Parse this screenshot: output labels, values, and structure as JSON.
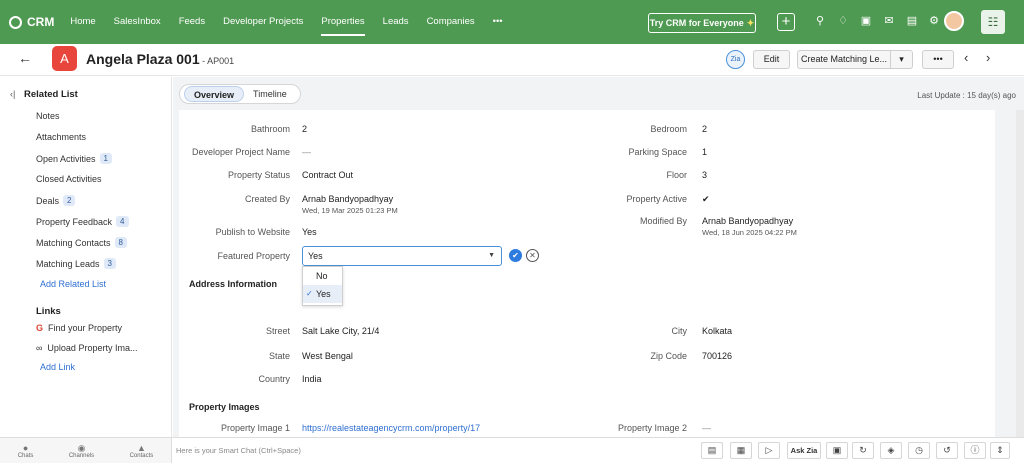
{
  "topbar": {
    "app_name": "CRM",
    "nav": [
      "Home",
      "SalesInbox",
      "Feeds",
      "Developer Projects",
      "Properties",
      "Leads",
      "Companies",
      "•••"
    ],
    "active_nav": "Properties",
    "try_button": "Try CRM for Everyone",
    "plus_label": "+",
    "icons": [
      "search-icon",
      "bell-icon",
      "calendar-icon",
      "mail-icon",
      "store-icon",
      "gear-icon"
    ],
    "apps_label": "☷",
    "accent": "#4f9a52"
  },
  "record": {
    "back": "←",
    "avatar_letter": "A",
    "title": "Angela Plaza 001",
    "code": " - AP001",
    "zia_label": "Zia",
    "edit_label": "Edit",
    "create_matching_label": "Create Matching Le...",
    "dropdown_caret": "▾",
    "more_label": "•••",
    "prev": "‹",
    "next": "›"
  },
  "sidebar": {
    "collapse_glyph": "‹|",
    "header": "Related List",
    "items": [
      {
        "label": "Notes",
        "count": ""
      },
      {
        "label": "Attachments",
        "count": ""
      },
      {
        "label": "Open Activities",
        "count": "1"
      },
      {
        "label": "Closed Activities",
        "count": ""
      },
      {
        "label": "Deals",
        "count": "2"
      },
      {
        "label": "Property Feedback",
        "count": "4"
      },
      {
        "label": "Matching Contacts",
        "count": "8"
      },
      {
        "label": "Matching Leads",
        "count": "3"
      }
    ],
    "add_related_list": "Add Related List",
    "links_header": "Links",
    "links": [
      "Find your Property",
      "Upload Property Ima..."
    ],
    "add_link": "Add Link"
  },
  "tabs": {
    "overview": "Overview",
    "timeline": "Timeline",
    "last_update": "Last Update : 15 day(s) ago"
  },
  "details": {
    "bathroom_label": "Bathroom",
    "bathroom_value": "2",
    "bedroom_label": "Bedroom",
    "bedroom_value": "2",
    "dev_project_label": "Developer Project Name",
    "dev_project_value": "—",
    "parking_label": "Parking Space",
    "parking_value": "1",
    "status_label": "Property Status",
    "status_value": "Contract Out",
    "floor_label": "Floor",
    "floor_value": "3",
    "created_by_label": "Created By",
    "created_by_value": "Arnab Bandyopadhyay",
    "created_on": "Wed, 19 Mar 2025 01:23 PM",
    "active_label": "Property Active",
    "active_value": "✔",
    "modified_by_label": "Modified By",
    "modified_by_value": "Arnab Bandyopadhyay",
    "modified_on": "Wed, 18 Jun 2025 04:22 PM",
    "publish_label": "Publish to Website",
    "publish_value": "Yes",
    "featured_label": "Featured Property",
    "featured_value": "Yes",
    "featured_options": [
      "No",
      "Yes"
    ],
    "featured_selected": "Yes",
    "check_glyph": "✓",
    "save_glyph": "✔",
    "cancel_glyph": "✕"
  },
  "address": {
    "section": "Address Information",
    "street_label": "Street",
    "street_value": "Salt Lake City, 21/4",
    "city_label": "City",
    "city_value": "Kolkata",
    "state_label": "State",
    "state_value": "West Bengal",
    "zip_label": "Zip Code",
    "zip_value": "700126",
    "country_label": "Country",
    "country_value": "India"
  },
  "images": {
    "section": "Property Images",
    "image1_label": "Property Image 1",
    "image1_value": "https://realestateagencycrm.com/property/17",
    "image2_label": "Property Image 2",
    "image2_value": "—"
  },
  "bottombar": {
    "tools": [
      "Chats",
      "Channels",
      "Contacts"
    ],
    "smart_chat": "Here is your Smart Chat (Ctrl+Space)",
    "ask_zia": "Ask Zia"
  }
}
